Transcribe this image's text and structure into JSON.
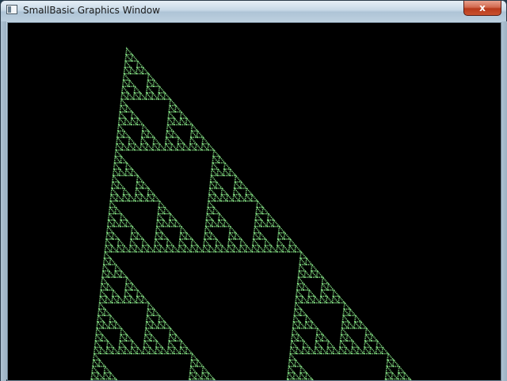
{
  "window": {
    "title": "SmallBasic Graphics Window",
    "close_label": "x"
  },
  "canvas": {
    "background": "#000000",
    "fractal_color": "#7fd77f",
    "fractal": "sierpinski-triangle"
  },
  "icons": {
    "app": "window-icon",
    "close": "close-icon"
  }
}
